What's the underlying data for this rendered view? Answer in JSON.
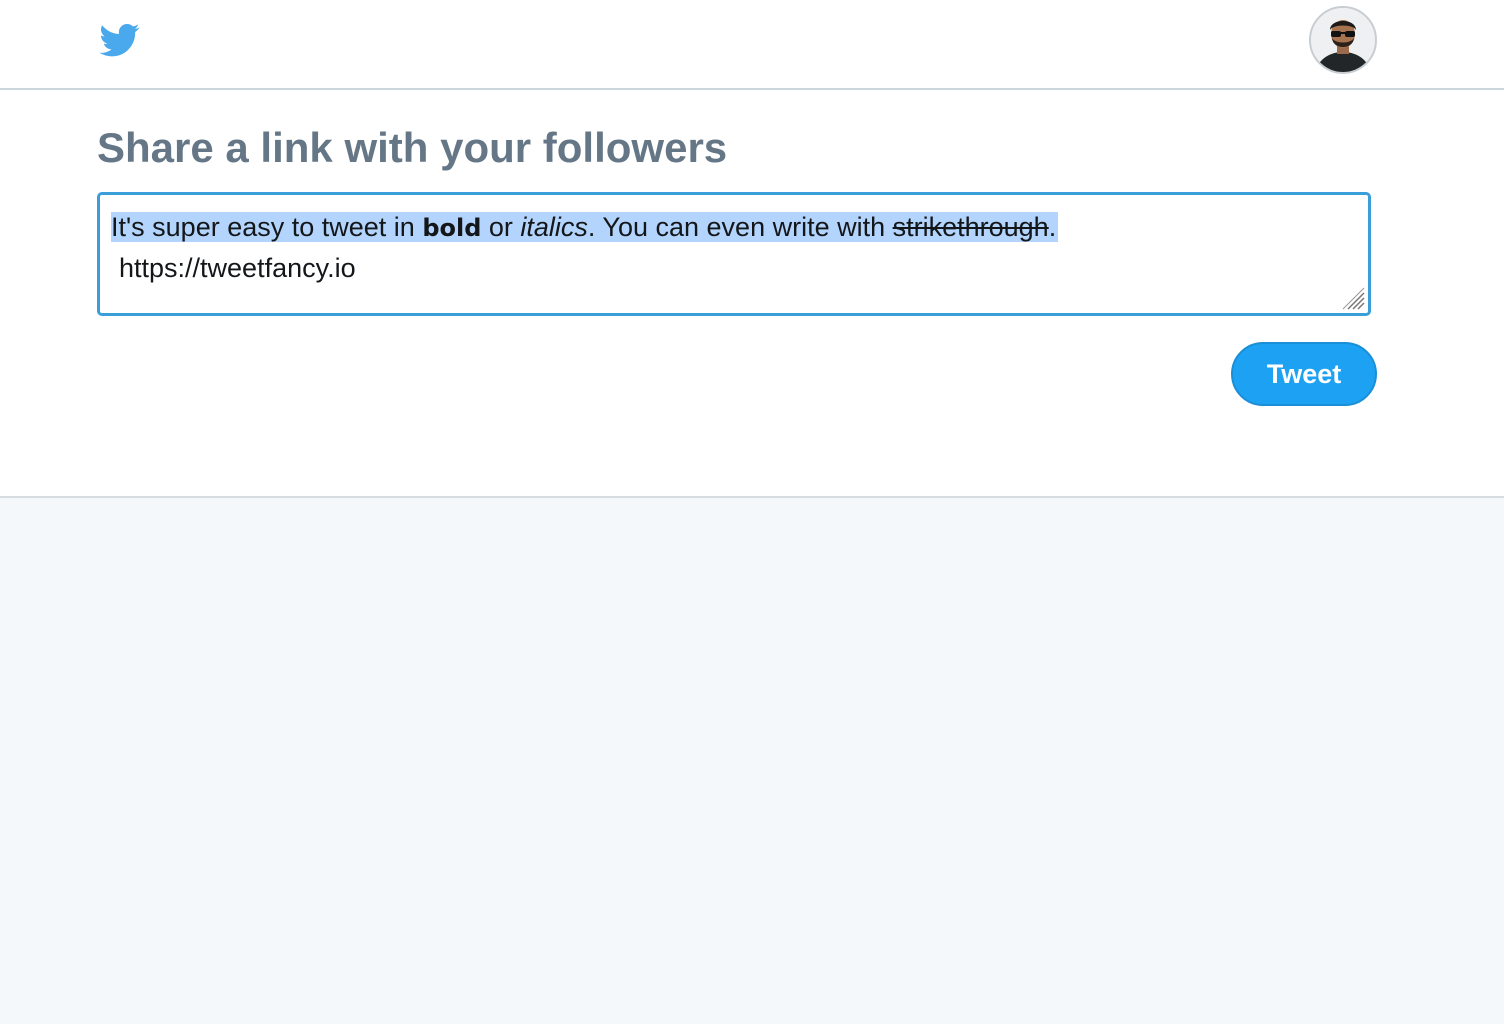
{
  "header": {
    "logo_icon": "twitter-bird-icon",
    "avatar_icon": "user-avatar",
    "brand_color": "#1da1f2"
  },
  "main": {
    "title": "Share a link with your followers",
    "composer": {
      "line1": {
        "part1": "It's super easy to tweet in ",
        "bold": "bold",
        "part2": " or ",
        "italic": "italics",
        "part3": ". You can even write with ",
        "strike": "strikethrough",
        "part4": "."
      },
      "line2": "https://tweetfancy.io",
      "selection_color": "#b3d4fc",
      "border_color": "#3a9fd9"
    },
    "tweet_button_label": "Tweet"
  }
}
